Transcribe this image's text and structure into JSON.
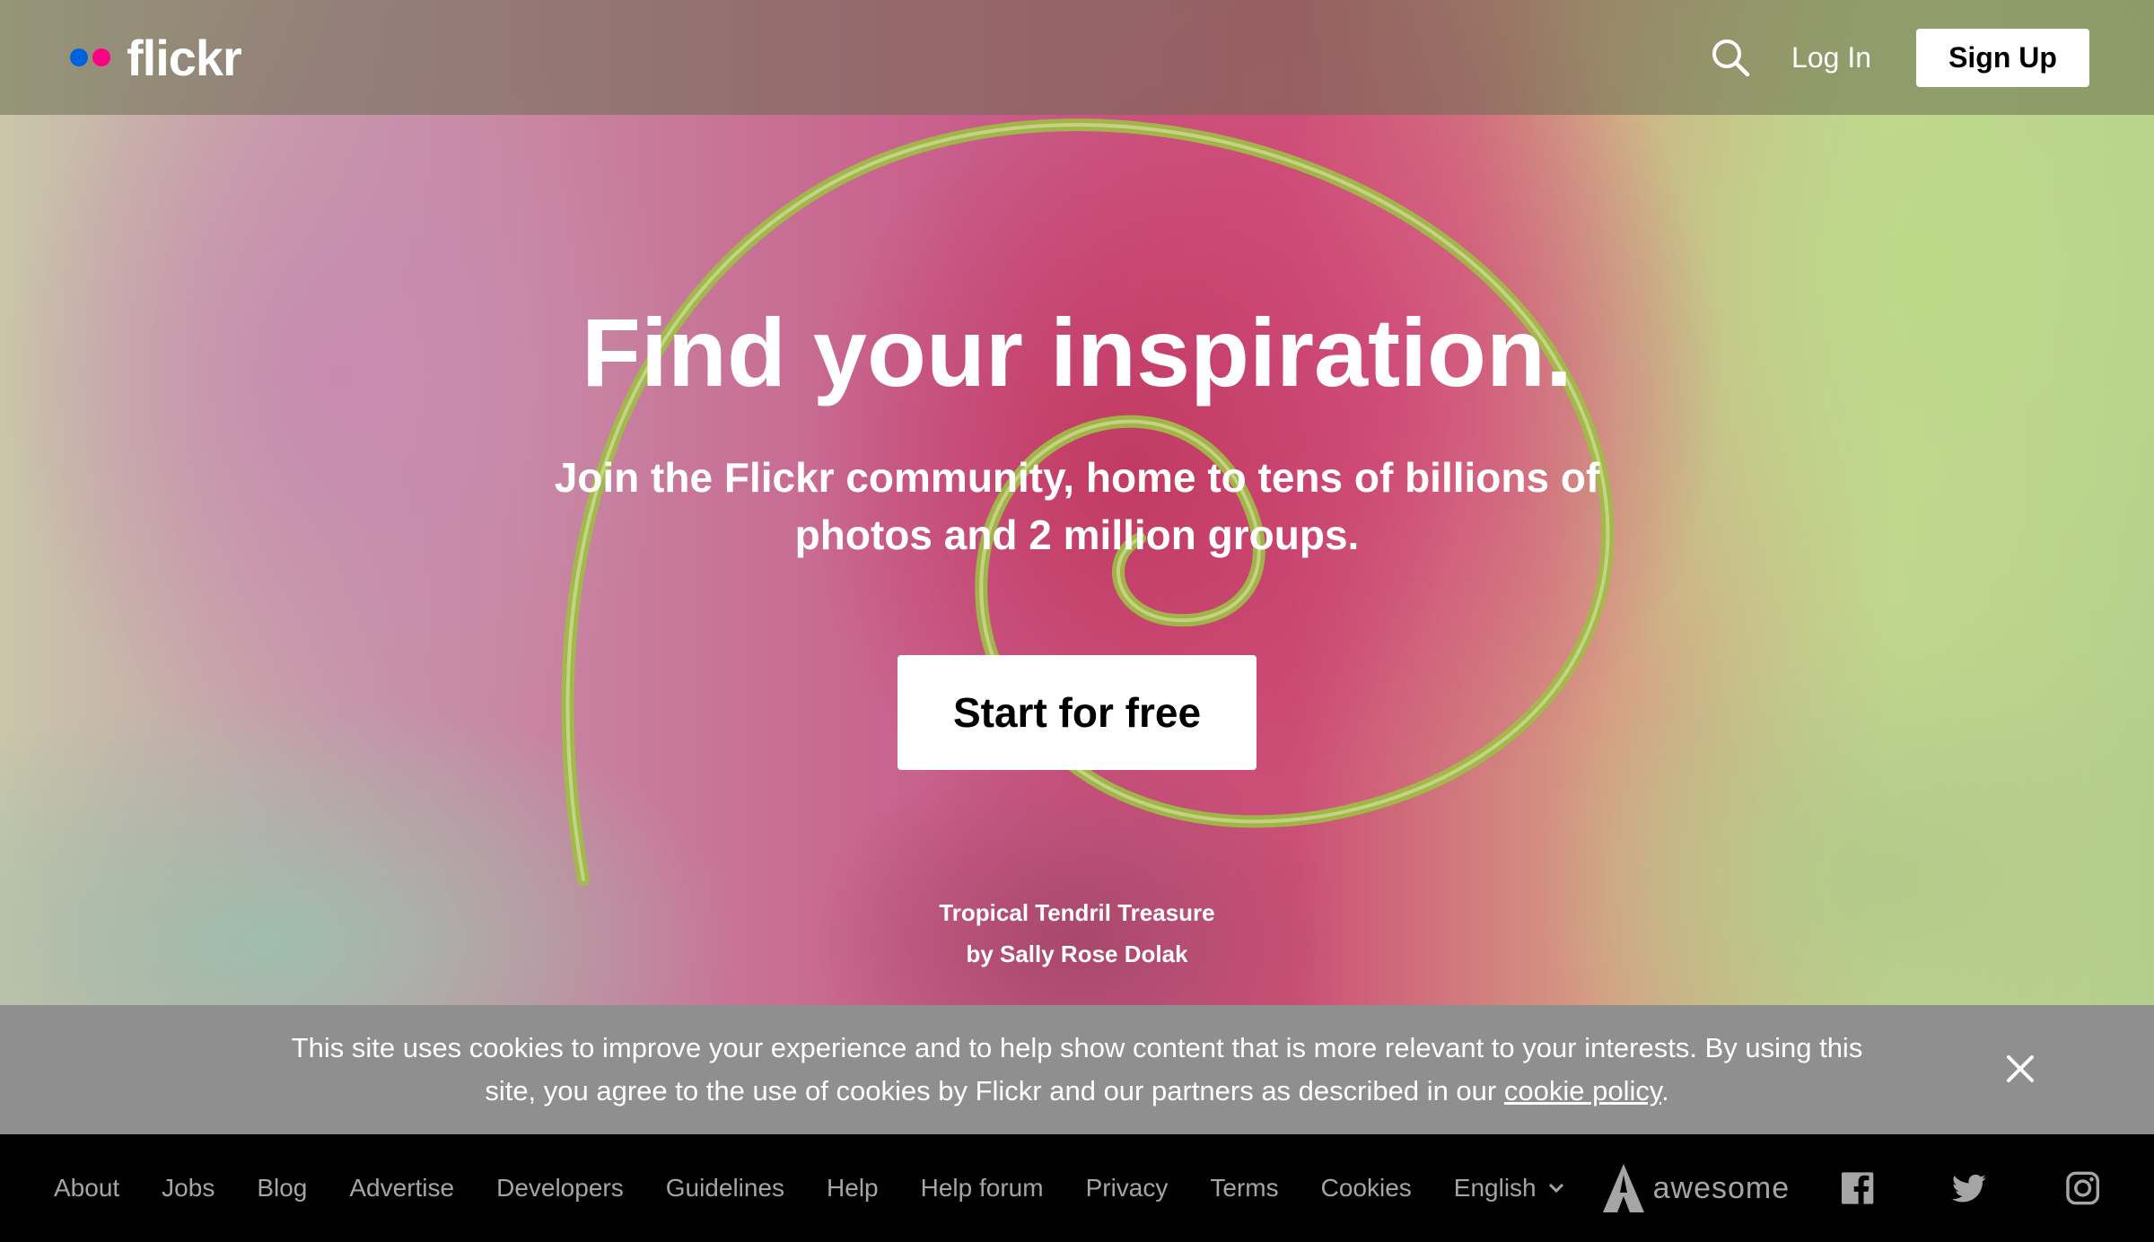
{
  "header": {
    "logo_text": "flickr",
    "login_label": "Log In",
    "signup_label": "Sign Up"
  },
  "hero": {
    "title": "Find your inspiration.",
    "subtitle": "Join the Flickr community, home to tens of billions of photos and 2 million groups.",
    "cta_label": "Start for free",
    "photo_title": "Tropical Tendril Treasure",
    "photo_author": "by Sally Rose Dolak"
  },
  "cookie_banner": {
    "text": "This site uses cookies to improve your experience and to help show content that is more relevant to your interests. By using this site, you agree to the use of cookies by Flickr and our partners as described in our",
    "link_text": "cookie policy",
    "trailing": "."
  },
  "footer": {
    "links": [
      "About",
      "Jobs",
      "Blog",
      "Advertise",
      "Developers",
      "Guidelines",
      "Help",
      "Help forum",
      "Privacy",
      "Terms",
      "Cookies"
    ],
    "language": "English",
    "awesome_text": "awesome"
  },
  "colors": {
    "dot_blue": "#0063dc",
    "dot_pink": "#ff0084",
    "cookie_bg": "#8f8f8f",
    "footer_text": "#a5a5a5"
  },
  "icons": [
    "search-icon",
    "close-icon",
    "chevron-down-icon",
    "awesome-logo-icon",
    "facebook-icon",
    "twitter-icon",
    "instagram-icon"
  ]
}
